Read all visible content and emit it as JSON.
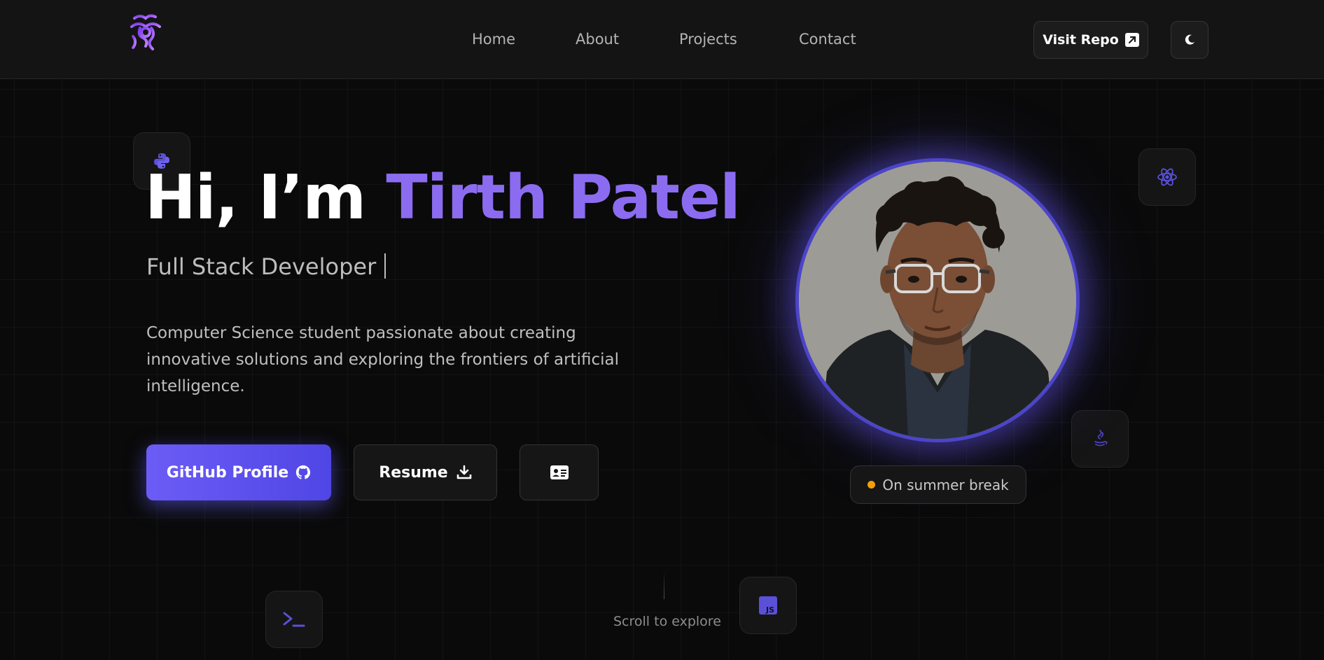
{
  "header": {
    "nav": [
      {
        "label": "Home"
      },
      {
        "label": "About"
      },
      {
        "label": "Projects"
      },
      {
        "label": "Contact"
      }
    ],
    "visit_repo_label": "Visit Repo",
    "theme_toggle_icon": "moon-icon"
  },
  "hero": {
    "greeting": "Hi, I’m ",
    "name": "Tirth Patel",
    "subtitle": "Full Stack Developer",
    "description": "Computer Science student passionate about creating innovative solutions and exploring the frontiers of artificial intelligence.",
    "github_button_label": "GitHub Profile",
    "resume_button_label": "Resume",
    "contact_card_icon": "id-card-icon"
  },
  "profile": {
    "status_text": "On summer break",
    "status_color": "#f59e0b"
  },
  "floating_icons": [
    "python-icon",
    "react-icon",
    "java-icon",
    "terminal-icon",
    "javascript-icon"
  ],
  "scroll_hint": "Scroll to explore",
  "colors": {
    "accent": "#8b6cf0",
    "button_gradient_start": "#6c5cf6",
    "button_gradient_end": "#4f46e5",
    "ring": "#4c45c9",
    "background": "#0a0a0a"
  }
}
